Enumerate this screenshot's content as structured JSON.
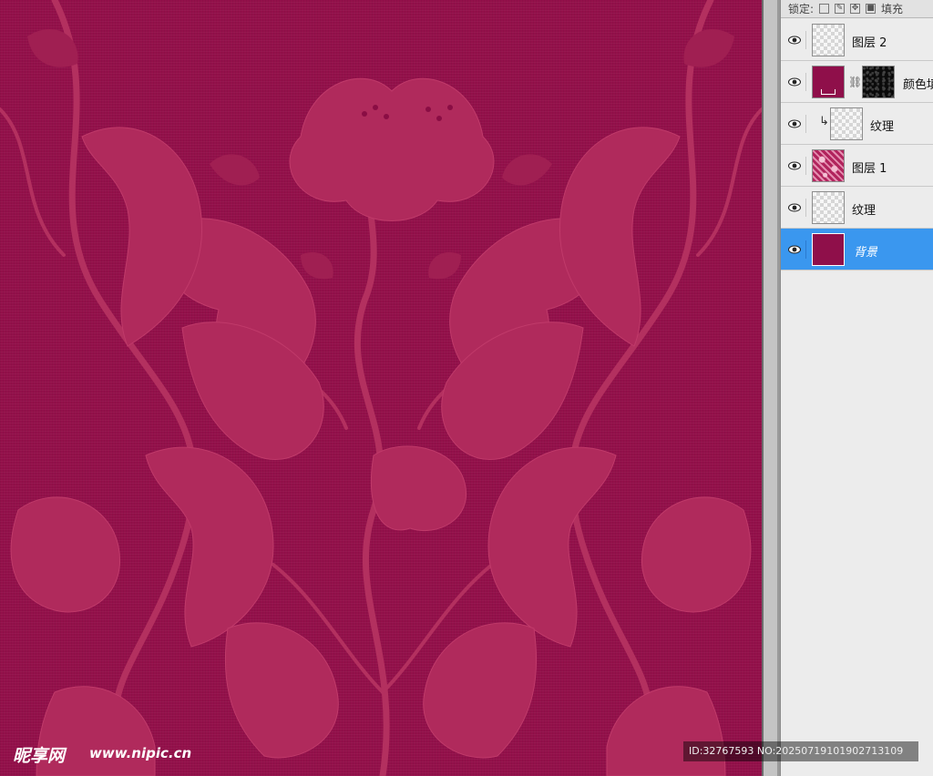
{
  "lock_bar": {
    "label": "锁定:",
    "fill_label": "填充"
  },
  "layers": [
    {
      "name": "图层 2",
      "thumb": "transparent",
      "visible": true,
      "selected": false
    },
    {
      "name": "颜色填充",
      "thumb": "solid-fill",
      "mask": true,
      "visible": true,
      "selected": false
    },
    {
      "name": "纹理",
      "thumb": "transparent",
      "clipped": true,
      "visible": true,
      "selected": false
    },
    {
      "name": "图层 1",
      "thumb": "pattern",
      "visible": true,
      "selected": false
    },
    {
      "name": "纹理",
      "thumb": "transparent",
      "visible": true,
      "selected": false
    },
    {
      "name": "背景",
      "thumb": "solid-fill",
      "visible": true,
      "selected": true
    }
  ],
  "canvas": {
    "base_color": "#93104a",
    "motif_color": "#b02a5c"
  },
  "selection_color": "#3a97ef",
  "watermark": {
    "logo": "昵享网",
    "site": "www.nipic.cn",
    "id_text": "ID:32767593 NO:20250719101902713109"
  }
}
